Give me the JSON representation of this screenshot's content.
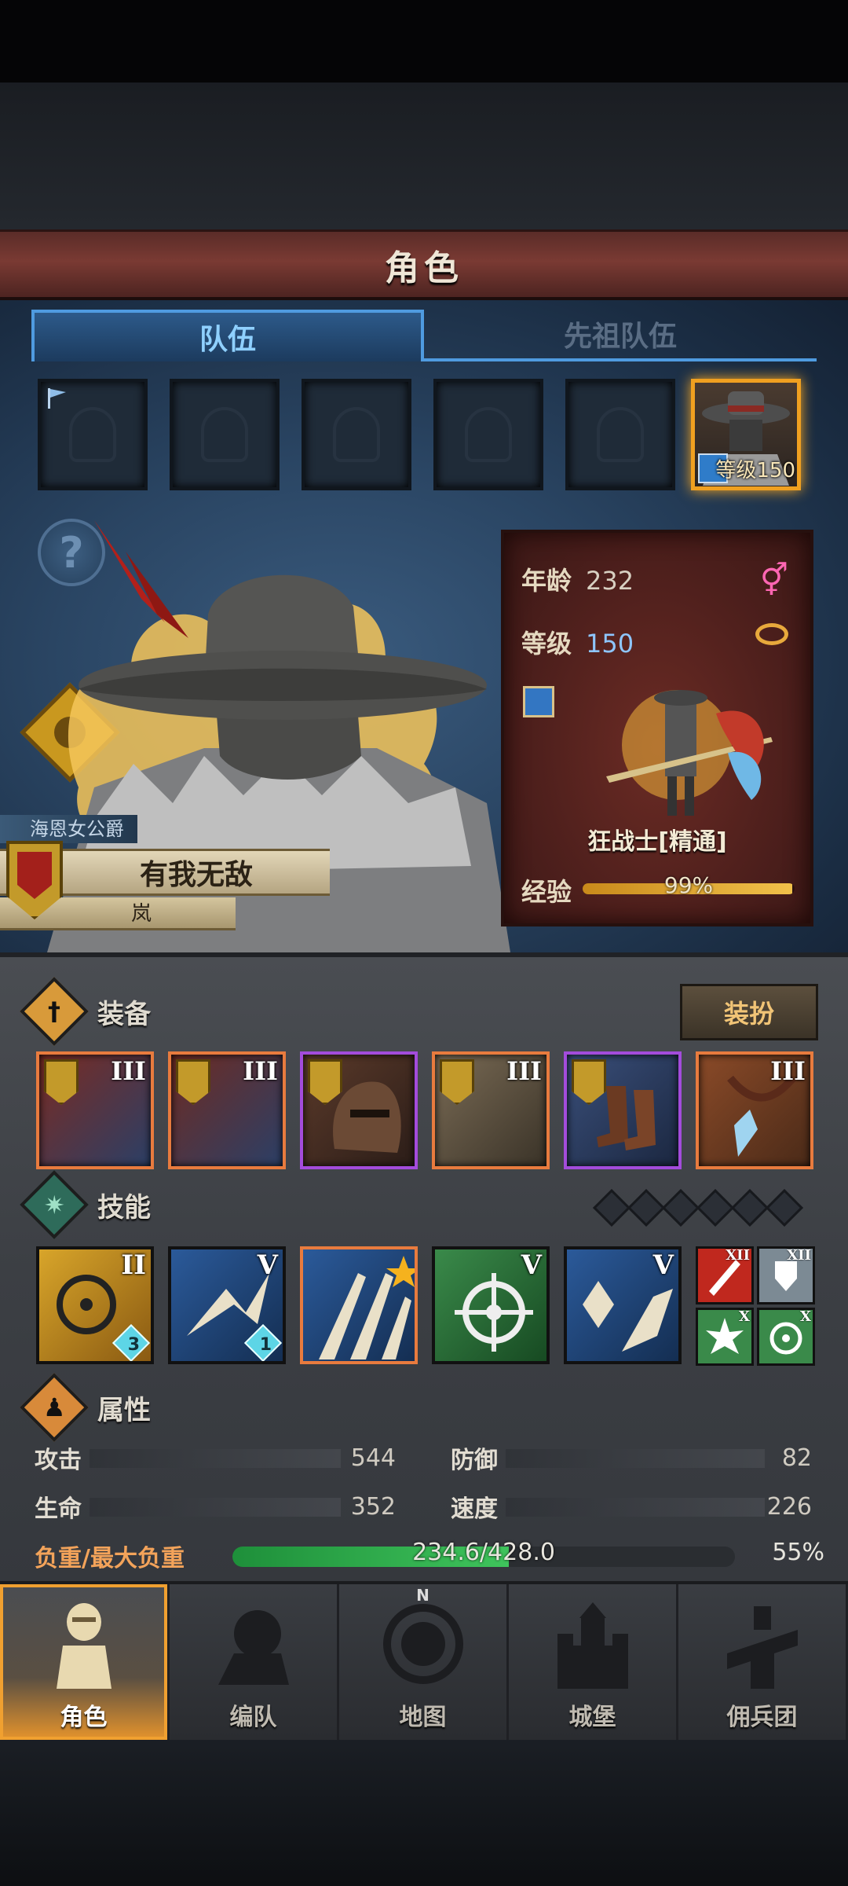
{
  "header": {
    "title": "角色"
  },
  "tabs": [
    {
      "label": "队伍"
    },
    {
      "label": "先祖队伍"
    }
  ],
  "team_slots": {
    "selected_level": "等级150"
  },
  "character": {
    "noble_title": "海恩女公爵",
    "motto": "有我无敌",
    "name": "岚",
    "age_label": "年龄",
    "age": "232",
    "level_label": "等级",
    "level": "150",
    "class_name": "狂战士[精通]",
    "exp_label": "经验",
    "exp_percent": "99%",
    "exp_fraction": 0.99
  },
  "equipment": {
    "label": "装备",
    "dress_button": "装扮",
    "items": [
      {
        "name": "weapon-1",
        "tier": "III",
        "rarity": "orange"
      },
      {
        "name": "weapon-2",
        "tier": "III",
        "rarity": "orange"
      },
      {
        "name": "helmet",
        "tier": "",
        "rarity": "purple"
      },
      {
        "name": "armor",
        "tier": "III",
        "rarity": "orange"
      },
      {
        "name": "boots",
        "tier": "",
        "rarity": "purple"
      },
      {
        "name": "amulet",
        "tier": "III",
        "rarity": "orange"
      }
    ]
  },
  "skills": {
    "label": "技能",
    "items": [
      {
        "tier": "II",
        "gem": "3"
      },
      {
        "tier": "V",
        "gem": "1"
      },
      {
        "tier": "",
        "gem": ""
      },
      {
        "tier": "V",
        "gem": ""
      },
      {
        "tier": "V",
        "gem": ""
      }
    ],
    "passives": [
      {
        "tier": "XII"
      },
      {
        "tier": "XII"
      },
      {
        "tier": "X"
      },
      {
        "tier": "X"
      }
    ]
  },
  "attributes": {
    "label": "属性",
    "attack_label": "攻击",
    "attack": "544",
    "defense_label": "防御",
    "defense": "82",
    "hp_label": "生命",
    "hp": "352",
    "speed_label": "速度",
    "speed": "226",
    "load_label": "负重/最大负重",
    "load_value": "234.6/428.0",
    "load_percent": "55%",
    "load_fraction": 0.55
  },
  "nav": [
    {
      "label": "角色",
      "icon": "knight-icon"
    },
    {
      "label": "编队",
      "icon": "formation-icon"
    },
    {
      "label": "地图",
      "icon": "compass-icon"
    },
    {
      "label": "城堡",
      "icon": "castle-icon"
    },
    {
      "label": "佣兵团",
      "icon": "mercenary-icon"
    }
  ],
  "colors": {
    "accent_orange": "#f0a020",
    "tab_blue": "#4f9be0",
    "rarity_orange": "#e87b3e",
    "rarity_purple": "#a34cdb",
    "load_green": "#3fc45c"
  }
}
